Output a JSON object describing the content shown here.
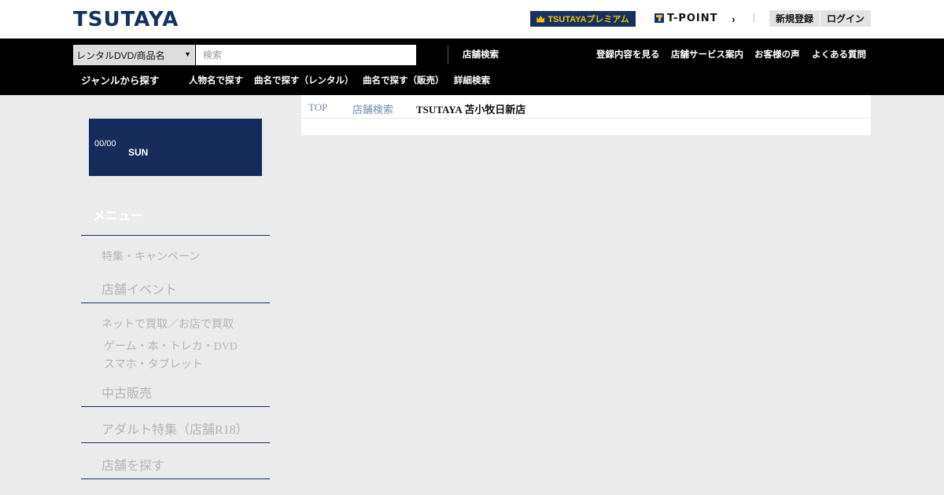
{
  "header": {
    "logo_text": "TSUTAYA",
    "premium_label": "TSUTAYAプレミアム",
    "tpoint_label": "T-POINT",
    "register_label": "新規登録",
    "login_label": "ログイン"
  },
  "search": {
    "category_selected": "レンタルDVD/商品名",
    "placeholder": "検索"
  },
  "nav": {
    "store_search": "店舗検索",
    "links_right": [
      "登録内容を見る",
      "店舗サービス案内",
      "お客様の声",
      "よくある質問"
    ],
    "genre": "ジャンルから探す",
    "links_bottom": [
      "人物名で探す",
      "曲名で探す（レンタル）",
      "曲名で探す（販売）",
      "詳細検索"
    ]
  },
  "datebox": {
    "date": "00/00",
    "day": "SUN"
  },
  "sidebar": {
    "menu_title": "メニュー",
    "items": [
      "特集・キャンペーン",
      "店舗イベント",
      "ネットで買取／お店で買取",
      "ゲーム・本・トレカ・DVD",
      "スマホ・タブレット",
      "中古販売",
      "アダルト特集（店舗R18）",
      "店舗を探す"
    ]
  },
  "breadcrumb": {
    "top": "TOP",
    "store_search": "店舗検索",
    "current": "TSUTAYA 苫小牧日新店"
  },
  "colors": {
    "brand_navy": "#163160",
    "premium_yellow": "#f3c300",
    "nav_black": "#000000",
    "page_bg": "#ebebeb",
    "crumb_link": "#6f8bb0"
  }
}
